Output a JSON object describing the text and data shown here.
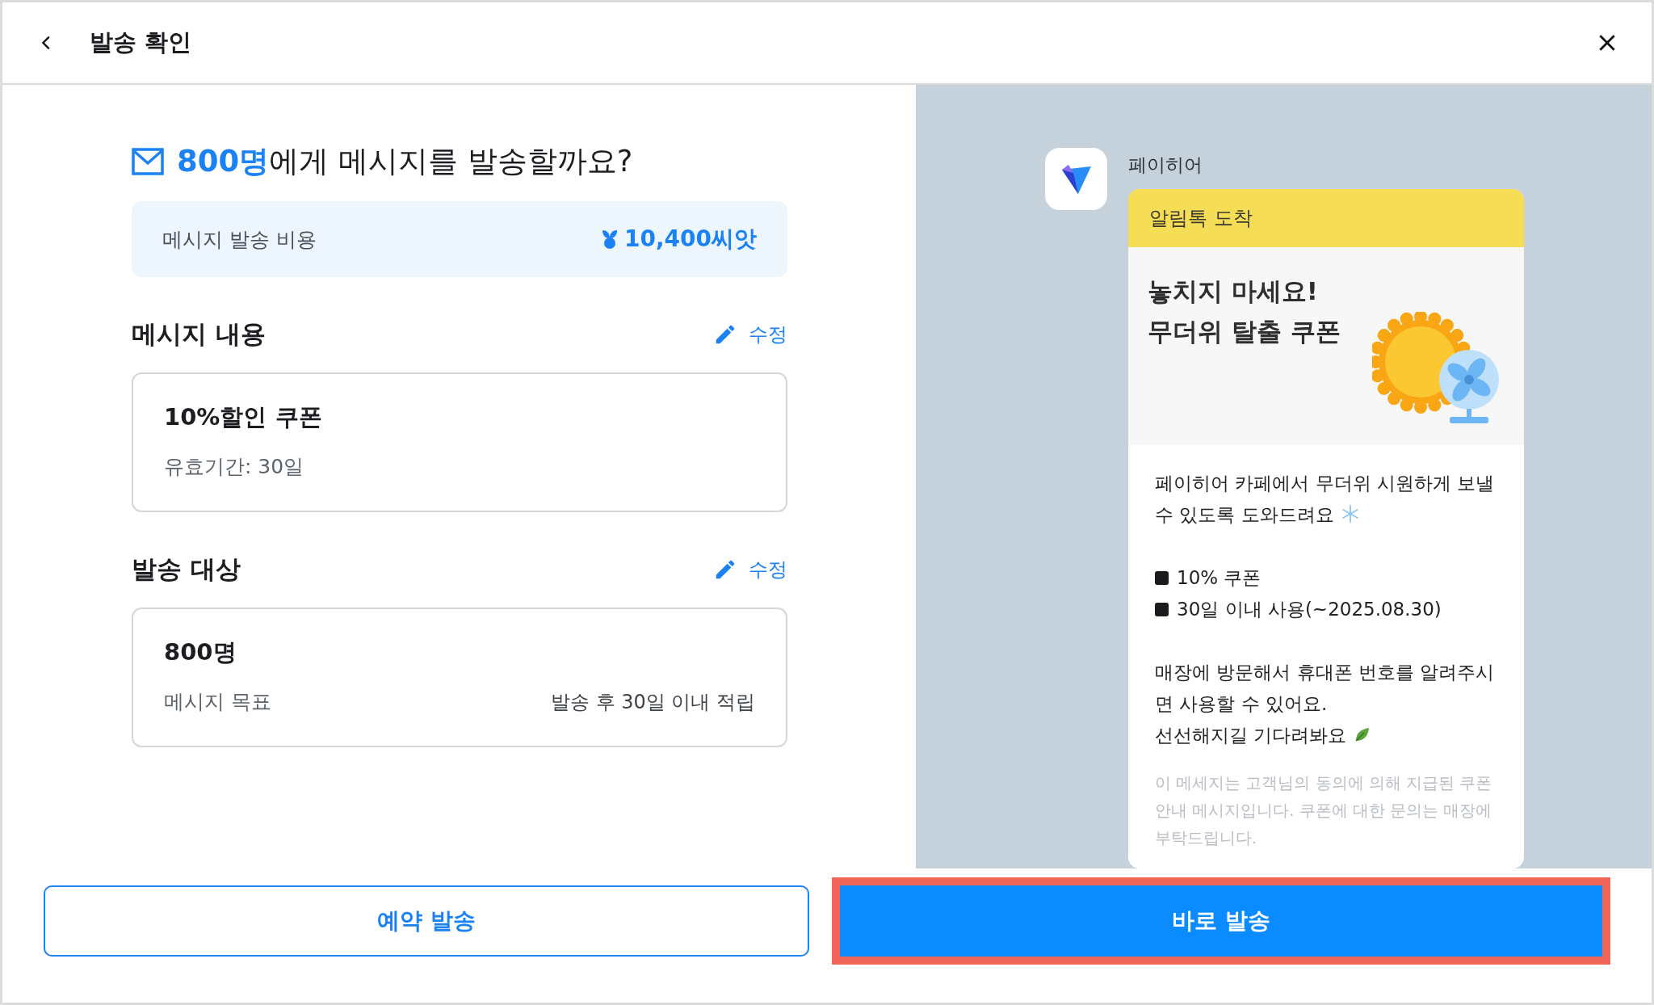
{
  "header": {
    "title": "발송 확인"
  },
  "question": {
    "count": "800명",
    "text": "에게 메시지를 발송할까요?"
  },
  "cost": {
    "label": "메시지 발송 비용",
    "amount": "10,400씨앗"
  },
  "sections": [
    {
      "title": "메시지 내용",
      "edit": "수정",
      "card": {
        "title": "10%할인 쿠폰",
        "subtitle": "유효기간: 30일"
      }
    },
    {
      "title": "발송 대상",
      "edit": "수정",
      "card": {
        "title": "800명",
        "subtitle": "메시지 목표",
        "note": "발송 후 30일 이내 적립"
      }
    }
  ],
  "preview": {
    "sender": "페이히어",
    "banner": "알림톡 도착",
    "headline": [
      "놓치지 마세요!",
      "무더위 탈출 쿠폰"
    ],
    "body": [
      {
        "kind": "paragraph",
        "lines": [
          {
            "text": "페이히어 카페에서 무더위 시원하게 보낼",
            "kind": "plain"
          },
          {
            "text": "수 있도록 도와드려요",
            "kind": "snowflake"
          }
        ]
      },
      {
        "kind": "bullets",
        "items": [
          "10% 쿠폰",
          "30일 이내 사용(~2025.08.30)"
        ]
      },
      {
        "kind": "paragraph",
        "lines": [
          {
            "text": "매장에 방문해서 휴대폰 번호를 알려주시",
            "kind": "plain"
          },
          {
            "text": "면 사용할 수 있어요.",
            "kind": "plain"
          },
          {
            "text": "선선해지길 기다려봐요",
            "kind": "leaf"
          }
        ]
      }
    ],
    "disclaimer": "이 메세지는 고객님의 동의에 의해 지급된 쿠폰 안내 메시지입니다.  쿠폰에 대한 문의는 매장에 부탁드립니다."
  },
  "buttons": [
    {
      "label": "예약 발송",
      "kind": "outline",
      "highlighted": false
    },
    {
      "label": "바로 발송",
      "kind": "primary",
      "highlighted": true
    }
  ]
}
